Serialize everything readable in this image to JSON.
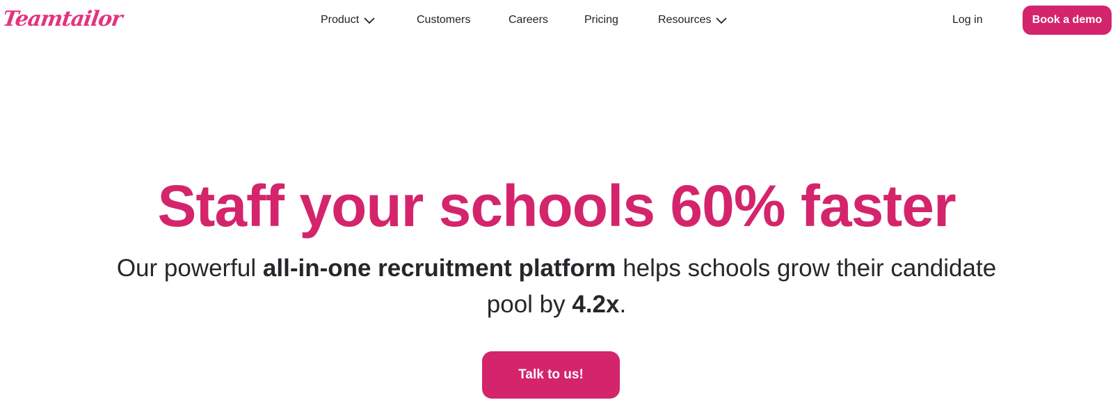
{
  "brand": {
    "logo_text": "Teamtailor",
    "accent_color": "#d4246c"
  },
  "nav": {
    "items": [
      {
        "label": "Product",
        "has_dropdown": true
      },
      {
        "label": "Customers",
        "has_dropdown": false
      },
      {
        "label": "Careers",
        "has_dropdown": false
      },
      {
        "label": "Pricing",
        "has_dropdown": false
      },
      {
        "label": "Resources",
        "has_dropdown": true
      }
    ],
    "login_label": "Log in",
    "demo_label": "Book a demo",
    "dropdown_icon": "chevron-down-icon"
  },
  "hero": {
    "title": "Staff your schools 60% faster",
    "subtitle_part1": "Our powerful ",
    "subtitle_bold1": "all-in-one recruitment platform",
    "subtitle_part2": " helps schools grow their candidate pool by ",
    "subtitle_bold2": "4.2x",
    "subtitle_part3": ".",
    "cta_label": "Talk to us!"
  }
}
